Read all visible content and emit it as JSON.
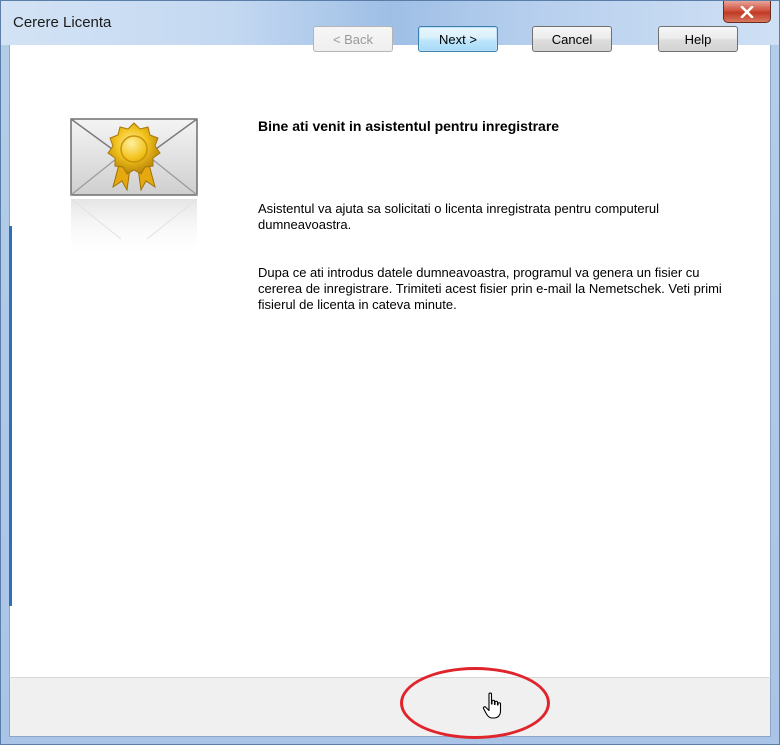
{
  "window": {
    "title": "Cerere Licenta",
    "close_label": "x"
  },
  "content": {
    "heading": "Bine ati venit in asistentul pentru inregistrare",
    "paragraph1": "Asistentul va ajuta sa solicitati o licenta inregistrata pentru computerul dumneavoastra.",
    "paragraph2": "Dupa ce ati introdus datele dumneavoastra, programul va genera un fisier cu cererea de inregistrare. Trimiteti acest fisier prin e-mail la Nemetschek. Veti primi fisierul de licenta in cateva minute."
  },
  "buttons": {
    "back": "< Back",
    "next": "Next >",
    "cancel": "Cancel",
    "help": "Help"
  },
  "colors": {
    "highlight": "#e0242c",
    "accent": "#2f6fb5"
  },
  "icons": {
    "hero": "envelope-certificate-icon",
    "close": "close-icon",
    "cursor": "hand-pointer-icon"
  }
}
